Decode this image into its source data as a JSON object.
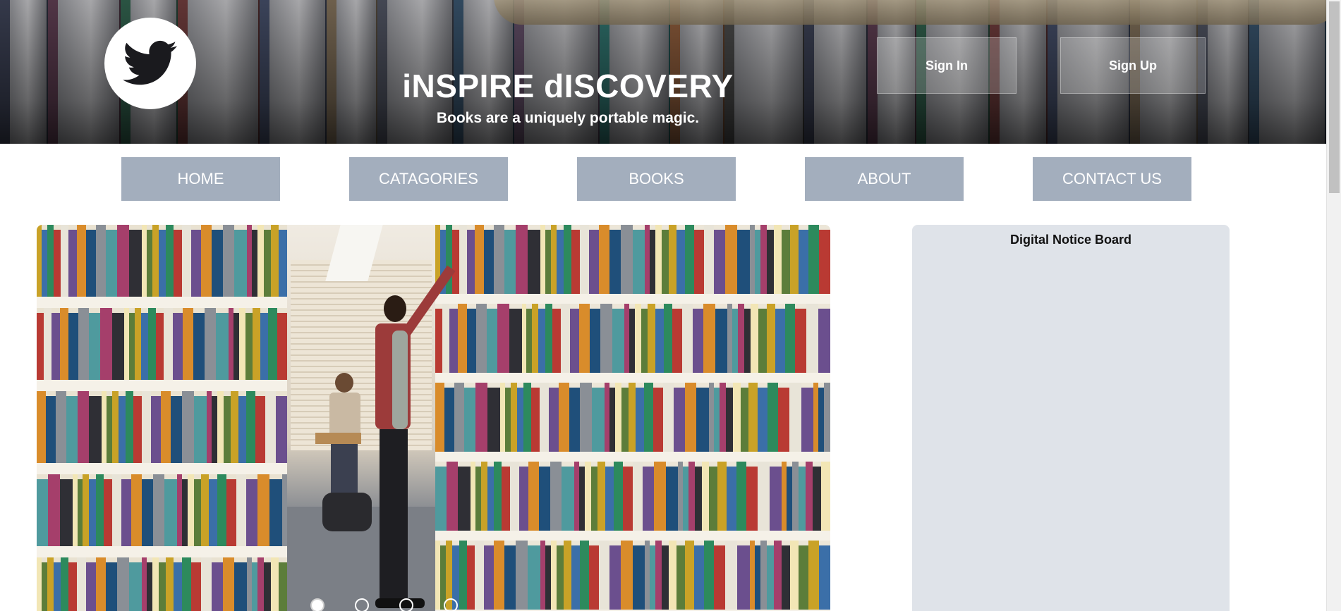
{
  "header": {
    "logo_icon": "twitter-bird-icon",
    "title": "iNSPIRE dISCOVERY",
    "subtitle": "Books are a uniquely portable magic.",
    "sign_in_label": "Sign In",
    "sign_up_label": "Sign Up"
  },
  "nav": {
    "items": [
      {
        "label": "HOME"
      },
      {
        "label": "CATAGORIES"
      },
      {
        "label": "BOOKS"
      },
      {
        "label": "ABOUT"
      },
      {
        "label": "CONTACT US"
      }
    ]
  },
  "carousel": {
    "image": "library-bookshelves-photo",
    "slide_count": 4,
    "active_slide": 1
  },
  "notice_board": {
    "title": "Digital Notice Board"
  },
  "colors": {
    "nav_button": "#a3aebd",
    "notice_board_bg": "#dfe3e9",
    "header_text": "#ffffff"
  }
}
